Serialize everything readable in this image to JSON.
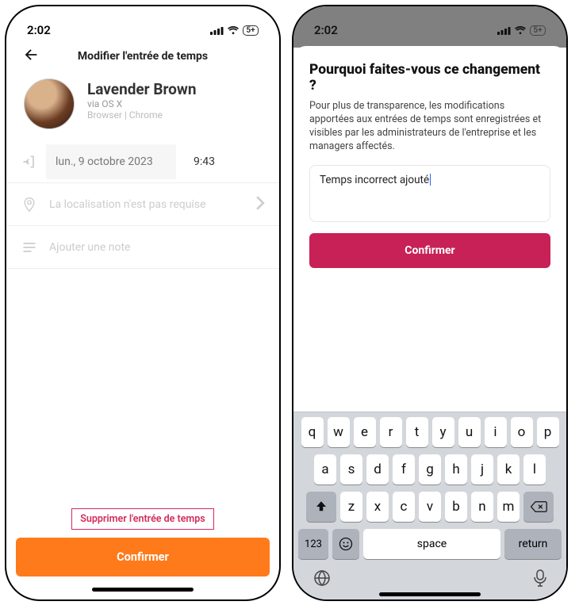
{
  "status": {
    "time": "2:02",
    "battery_label": "5+"
  },
  "phone1": {
    "header_title": "Modifier l'entrée de temps",
    "profile": {
      "name": "Lavender Brown",
      "sub1": "via OS X",
      "sub2": "Browser | Chrome"
    },
    "entry": {
      "date_display": "lun., 9 octobre 2023",
      "time_display": "9:43",
      "location_placeholder": "La localisation n'est pas requise",
      "note_placeholder": "Ajouter une note"
    },
    "delete_label": "Supprimer l'entrée de temps",
    "confirm_label": "Confirmer"
  },
  "phone2": {
    "modal_title": "Pourquoi faites-vous ce changement ?",
    "modal_description": "Pour plus de transparence, les modifications apportées aux entrées de temps sont enregistrées et visibles par les administrateurs de l'entreprise et les managers affectés.",
    "reason_value": "Temps incorrect ajouté",
    "confirm_label": "Confirmer",
    "keyboard": {
      "row1": [
        "q",
        "w",
        "e",
        "r",
        "t",
        "y",
        "u",
        "i",
        "o",
        "p"
      ],
      "row2": [
        "a",
        "s",
        "d",
        "f",
        "g",
        "h",
        "j",
        "k",
        "l"
      ],
      "row3": [
        "z",
        "x",
        "c",
        "v",
        "b",
        "n",
        "m"
      ],
      "space_label": "space",
      "return_label": "return",
      "mode_label": "123"
    }
  }
}
